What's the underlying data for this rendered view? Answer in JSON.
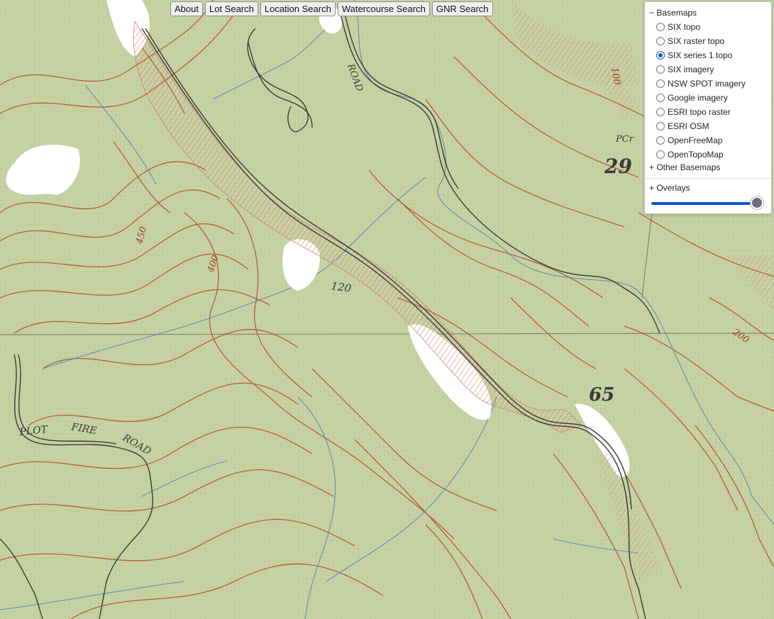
{
  "toolbar": {
    "buttons": [
      "About",
      "Lot Search",
      "Location Search",
      "Watercourse Search",
      "GNR Search"
    ]
  },
  "layer_panel": {
    "basemaps_heading": "− Basemaps",
    "basemaps": [
      {
        "label": "SIX topo",
        "selected": false
      },
      {
        "label": "SIX raster topo",
        "selected": false
      },
      {
        "label": "SIX series 1 topo",
        "selected": true
      },
      {
        "label": "SIX imagery",
        "selected": false
      },
      {
        "label": "NSW SPOT imagery",
        "selected": false
      },
      {
        "label": "Google imagery",
        "selected": false
      },
      {
        "label": "ESRI topo raster",
        "selected": false
      },
      {
        "label": "ESRI OSM",
        "selected": false
      },
      {
        "label": "OpenFreeMap",
        "selected": false
      },
      {
        "label": "OpenTopoMap",
        "selected": false
      }
    ],
    "other_basemaps": "+ Other Basemaps",
    "overlays_heading": "+ Overlays",
    "opacity": 1.0
  },
  "map": {
    "labels": {
      "road_top": "ROAD",
      "plot_fire_road": [
        "PLOT",
        "FIRE",
        "ROAD"
      ],
      "contour_400": "400",
      "contour_450": "450",
      "contour_120": "120",
      "contour_200": "200",
      "contour_100": "100",
      "peak_29": "29",
      "peak_29_prefix": "PCr",
      "peak_65": "65"
    },
    "colors": {
      "terrain": "#c6d1a2",
      "contour": "#b4472e",
      "creek": "#4a86b8",
      "road": "#3a3a3a",
      "clearing": "#ffffff"
    }
  }
}
